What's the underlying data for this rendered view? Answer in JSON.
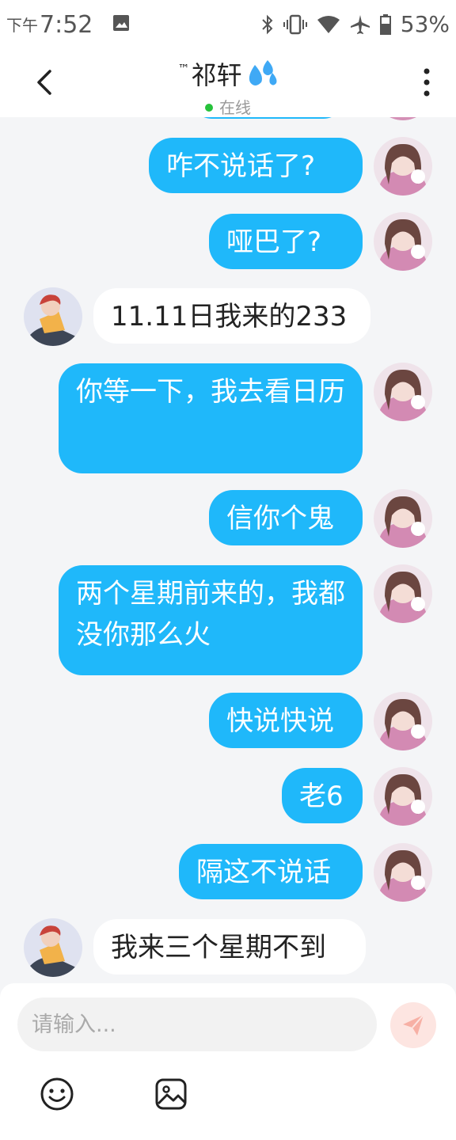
{
  "status_bar": {
    "ampm": "下午",
    "time": "7:52",
    "battery": "53%"
  },
  "header": {
    "tm": "™",
    "title": "祁轩",
    "title_emoji_icon": "sweat-droplets-icon",
    "status": "在线"
  },
  "messages": [
    {
      "side": "me",
      "text": "咋不说话了?"
    },
    {
      "side": "me",
      "text": "哑巴了?"
    },
    {
      "side": "other",
      "text": "11.11日我来的233"
    },
    {
      "side": "me",
      "text": "你等一下，我去看日历"
    },
    {
      "side": "me",
      "text": "信你个鬼"
    },
    {
      "side": "me",
      "text": "两个星期前来的，我都没你那么火"
    },
    {
      "side": "me",
      "text": "快说快说"
    },
    {
      "side": "me",
      "text": "老6"
    },
    {
      "side": "me",
      "text": "隔这不说话"
    },
    {
      "side": "other",
      "text": "我来三个星期不到"
    }
  ],
  "input": {
    "placeholder": "请输入..."
  },
  "icons": {
    "back": "back-arrow-icon",
    "more": "more-vertical-icon",
    "send": "send-icon",
    "emoji": "emoji-icon",
    "image": "image-icon"
  },
  "colors": {
    "my_bubble": "#1fb8fa",
    "other_bubble": "#ffffff",
    "background": "#f4f5f7",
    "online": "#26c23b",
    "send_button": "#fde5e1"
  }
}
